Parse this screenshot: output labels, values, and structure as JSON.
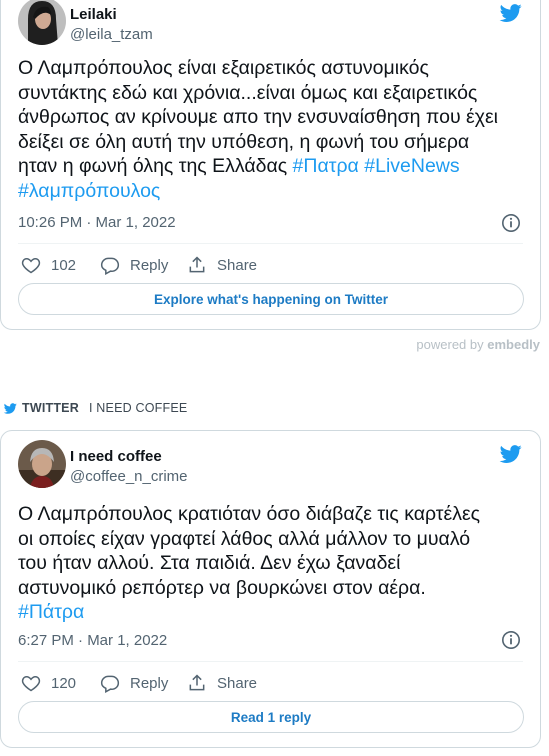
{
  "colors": {
    "accent": "#1d9bf0",
    "text": "#0f1419",
    "muted": "#536471",
    "border": "#cfd9de"
  },
  "tweet1": {
    "author_name": "Leilaki",
    "author_handle": "@leila_tzam",
    "avatar_icon": "avatar-photo-icon",
    "text_lines": [
      "Ο Λαμπρόπουλος είναι εξαιρετικός αστυνομικός",
      "συντάκτης εδώ και χρόνια...είναι όμως και εξαιρετικός",
      "άνθρωπος αν κρίνουμε απο την ενσυναίσθηση που έχει",
      "δείξει σε όλη αυτή την υπόθεση, η φωνή του σήμερα"
    ],
    "line5_text": "ηταν η φωνή όλης της Ελλάδας",
    "hashtags": [
      "#Πατρα",
      "#LiveNews",
      "#λαμπρόπουλος"
    ],
    "timestamp": "10:26 PM · Mar 1, 2022",
    "like_count": "102",
    "reply_label": "Reply",
    "share_label": "Share",
    "cta_label": "Explore what's happening on Twitter"
  },
  "embedly": {
    "powered_by": "powered by",
    "brand": "embedly"
  },
  "section_label": {
    "brand": "TWITTER",
    "title": "I NEED COFFEE"
  },
  "tweet2": {
    "author_name": "I need coffee",
    "author_handle": "@coffee_n_crime",
    "avatar_icon": "avatar-photo-icon",
    "text_lines": [
      "Ο Λαμπρόπουλος κρατιόταν όσο διάβαζε τις καρτέλες",
      "οι οποίες είχαν γραφτεί λάθος αλλά μάλλον το μυαλό",
      "του ήταν αλλού. Στα παιδιά. Δεν έχω ξαναδεί",
      "αστυνομικό ρεπόρτερ να βουρκώνει στον αέρα."
    ],
    "hashtags": [
      "#Πάτρα"
    ],
    "timestamp": "6:27 PM · Mar 1, 2022",
    "like_count": "120",
    "reply_label": "Reply",
    "share_label": "Share",
    "cta_label": "Read 1 reply"
  }
}
